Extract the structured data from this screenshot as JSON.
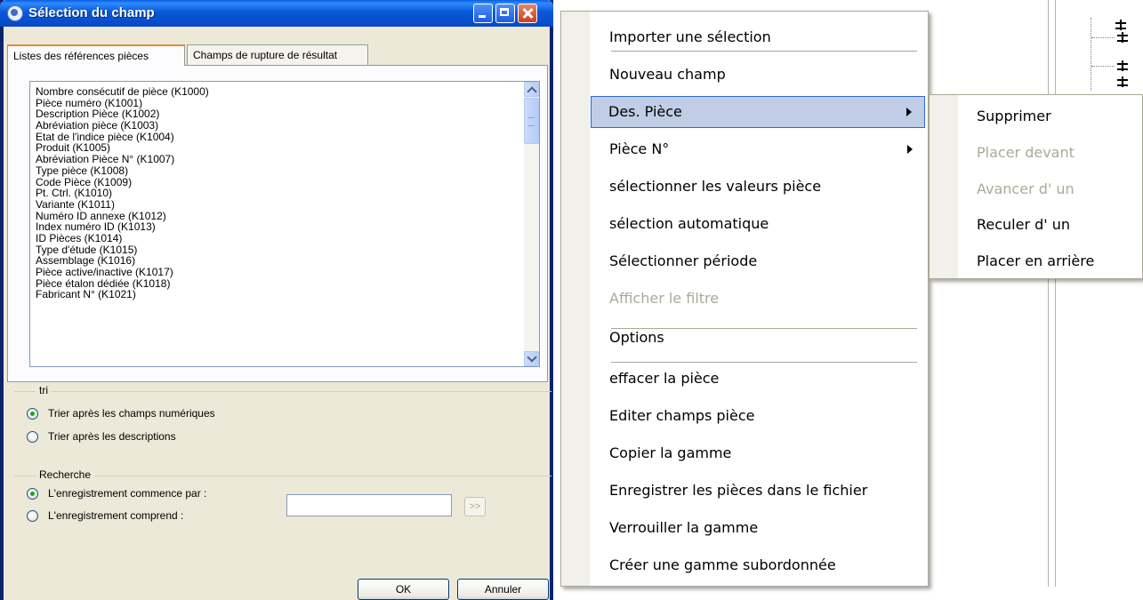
{
  "dialog": {
    "title": "Sélection du champ",
    "tabs": [
      {
        "label": "Listes des références pièces",
        "active": true
      },
      {
        "label": "Champs de rupture de résultat",
        "active": false
      }
    ],
    "list_items": [
      "Nombre consécutif de pièce (K1000)",
      "Pièce numéro (K1001)",
      "Description Pièce (K1002)",
      "Abréviation pièce (K1003)",
      "Etat de l'indice pièce (K1004)",
      "Produit (K1005)",
      "Abréviation Pièce N° (K1007)",
      "Type pièce (K1008)",
      "Code Pièce (K1009)",
      "Pt. Ctrl. (K1010)",
      "Variante (K1011)",
      "Numéro ID annexe (K1012)",
      "Index numéro ID (K1013)",
      "ID Pièces (K1014)",
      "Type d'étude (K1015)",
      "Assemblage (K1016)",
      "Pièce active/inactive (K1017)",
      "Pièce étalon dédiée (K1018)",
      "Fabricant N° (K1021)"
    ],
    "sort_group": {
      "label": "tri",
      "options": [
        {
          "label": "Trier après les champs numériques",
          "checked": true
        },
        {
          "label": "Trier après les descriptions",
          "checked": false
        }
      ]
    },
    "search_group": {
      "label": "Recherche",
      "options": [
        {
          "label": "L'enregistrement commence par :",
          "checked": true
        },
        {
          "label": "L'enregistrement comprend :",
          "checked": false
        }
      ],
      "input_value": "",
      "go_label": ">>"
    },
    "ok_label": "OK",
    "cancel_label": "Annuler"
  },
  "context_menu": {
    "items": [
      {
        "label": "Importer une sélection",
        "disabled": false,
        "submenu": false
      },
      {
        "label": "Nouveau champ",
        "disabled": false,
        "submenu": false
      },
      {
        "label": "Des. Pièce",
        "disabled": false,
        "submenu": true,
        "highlighted": true
      },
      {
        "label": "Pièce N°",
        "disabled": false,
        "submenu": true
      },
      {
        "label": "sélectionner les valeurs pièce",
        "disabled": false,
        "submenu": false
      },
      {
        "label": "sélection automatique",
        "disabled": false,
        "submenu": false
      },
      {
        "label": "Sélectionner période",
        "disabled": false,
        "submenu": false
      },
      {
        "label": "Afficher le filtre",
        "disabled": true,
        "submenu": false
      },
      {
        "label": "Options",
        "disabled": false,
        "submenu": false
      },
      {
        "label": "effacer la pièce",
        "disabled": false,
        "submenu": false
      },
      {
        "label": "Editer champs pièce",
        "disabled": false,
        "submenu": false
      },
      {
        "label": "Copier la gamme",
        "disabled": false,
        "submenu": false
      },
      {
        "label": "Enregistrer les pièces dans le fichier",
        "disabled": false,
        "submenu": false
      },
      {
        "label": "Verrouiller la gamme",
        "disabled": false,
        "submenu": false
      },
      {
        "label": "Créer une gamme subordonnée",
        "disabled": false,
        "submenu": false
      }
    ]
  },
  "submenu": {
    "items": [
      {
        "label": "Supprimer",
        "disabled": false
      },
      {
        "label": "Placer devant",
        "disabled": true
      },
      {
        "label": "Avancer d' un",
        "disabled": true
      },
      {
        "label": "Reculer d' un",
        "disabled": false
      },
      {
        "label": "Placer en arrière",
        "disabled": false
      }
    ]
  },
  "colors": {
    "dialog_bg": "#ece9d8",
    "titlebar": "#0a58d8",
    "menu_highlight": "#c0cde6",
    "menu_highlight_border": "#316ac5",
    "disabled_text": "#aca899",
    "radio_checked": "#21a121"
  },
  "icons": {
    "title": "app-window-icon",
    "minimize": "minimize-icon",
    "maximize": "maximize-icon",
    "close": "close-icon",
    "submenu_arrow": "chevron-right-icon",
    "tree_node": "tree-node-icon"
  }
}
